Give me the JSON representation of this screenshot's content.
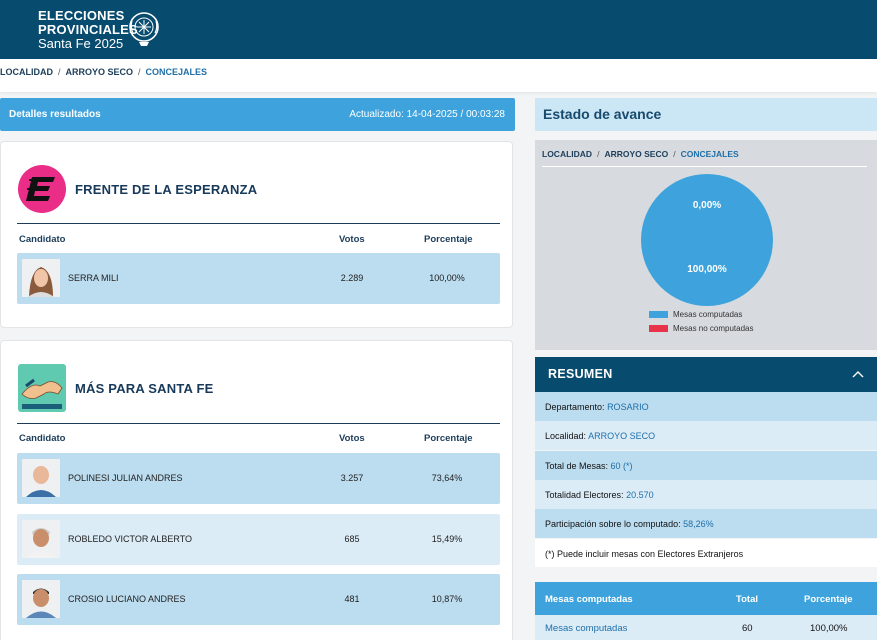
{
  "header": {
    "logo_line1": "ELECCIONES",
    "logo_line2": "PROVINCIALES",
    "logo_line3": "Santa Fe 2025",
    "seal_icon": "provincial-seal-icon"
  },
  "breadcrumb": {
    "items": [
      "LOCALIDAD",
      "ARROYO SECO",
      "CONCEJALES"
    ],
    "sep": "/"
  },
  "details": {
    "title": "Detalles resultados",
    "updated_label": "Actualizado:",
    "updated_value": "14-04-2025 / 00:03:28"
  },
  "columns": {
    "candidate": "Candidato",
    "votes": "Votos",
    "percentage": "Porcentaje"
  },
  "parties": [
    {
      "name": "FRENTE DE LA ESPERANZA",
      "logo_icon": "frente-esperanza-logo",
      "candidates": [
        {
          "name": "SERRA MILI",
          "votes": "2.289",
          "percentage": "100,00%"
        }
      ]
    },
    {
      "name": "MÁS PARA SANTA FE",
      "logo_icon": "mas-para-santa-fe-logo",
      "candidates": [
        {
          "name": "POLINESI JULIAN ANDRES",
          "votes": "3.257",
          "percentage": "73,64%"
        },
        {
          "name": "ROBLEDO VICTOR ALBERTO",
          "votes": "685",
          "percentage": "15,49%"
        },
        {
          "name": "CROSIO LUCIANO ANDRES",
          "votes": "481",
          "percentage": "10,87%"
        }
      ]
    }
  ],
  "estado": {
    "title": "Estado de avance",
    "pie": {
      "label_top": "0,00%",
      "label_bottom": "100,00%",
      "computed_fraction": 1.0
    },
    "legend": [
      {
        "label": "Mesas computadas",
        "color": "#3ea3dc"
      },
      {
        "label": "Mesas no computadas",
        "color": "#e8334a"
      }
    ]
  },
  "resumen": {
    "title": "RESUMEN",
    "rows": [
      {
        "label": "Departamento:",
        "value": "ROSARIO"
      },
      {
        "label": "Localidad:",
        "value": "ARROYO SECO"
      },
      {
        "label": "Total de Mesas:",
        "value": "60 (*)"
      },
      {
        "label": "Totalidad Electores:",
        "value": "20.570"
      },
      {
        "label": "Participación sobre lo computado:",
        "value": "58,26%"
      }
    ],
    "note": "(*) Puede incluir mesas con Electores Extranjeros"
  },
  "mesas_table": {
    "headers": [
      "Mesas computadas",
      "Total",
      "Porcentaje"
    ],
    "rows": [
      {
        "label": "Mesas computadas",
        "total": "60",
        "percentage": "100,00%"
      }
    ]
  },
  "colors": {
    "navy": "#074b6f",
    "accent_blue": "#3ea3dc",
    "row_dark": "#bcdcef",
    "row_light": "#dcecf7",
    "pink": "#e8334a"
  }
}
